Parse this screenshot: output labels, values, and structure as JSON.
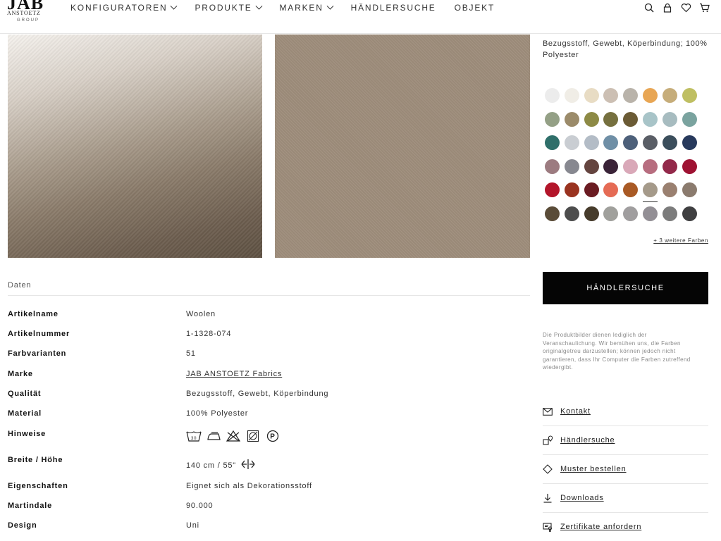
{
  "header": {
    "logo_main": "JAB",
    "logo_sub": "ANSTOETZ",
    "logo_group": "GROUP",
    "nav": [
      {
        "label": "KONFIGURATOREN",
        "has_dropdown": true
      },
      {
        "label": "PRODUKTE",
        "has_dropdown": true
      },
      {
        "label": "MARKEN",
        "has_dropdown": true
      },
      {
        "label": "HÄNDLERSUCHE",
        "has_dropdown": false
      },
      {
        "label": "OBJEKT",
        "has_dropdown": false
      }
    ],
    "icons": [
      "search-icon",
      "lock-icon",
      "heart-icon",
      "cart-icon"
    ]
  },
  "product": {
    "description": "Bezugsstoff, Gewebt, Köperbindung; 100% Polyester",
    "image_colors": {
      "detail_image": "#8a7b6a",
      "flat_image": "#a08f7d"
    }
  },
  "data": {
    "title": "Daten",
    "rows": [
      {
        "key": "Artikelname",
        "value": "Woolen"
      },
      {
        "key": "Artikelnummer",
        "value": "1-1328-074"
      },
      {
        "key": "Farbvarianten",
        "value": "51"
      },
      {
        "key": "Marke",
        "value": "JAB ANSTOETZ Fabrics",
        "link": true
      },
      {
        "key": "Qualität",
        "value": "Bezugsstoff, Gewebt, Köperbindung"
      },
      {
        "key": "Material",
        "value": "100% Polyester"
      },
      {
        "key": "Hinweise",
        "value": "",
        "care_icons": [
          "wash-30-icon",
          "iron-icon",
          "no-bleach-icon",
          "tumble-dry-icon",
          "professional-clean-p-icon"
        ]
      },
      {
        "key": "Breite / Höhe",
        "value": "140 cm / 55\"",
        "icon": "railroaded-icon"
      },
      {
        "key": "Eigenschaften",
        "value": "Eignet sich als Dekorationsstoff"
      },
      {
        "key": "Martindale",
        "value": "90.000"
      },
      {
        "key": "Design",
        "value": "Uni"
      }
    ]
  },
  "colors": {
    "swatches": [
      "#ececec",
      "#f0ede6",
      "#e8dcc4",
      "#ccbfb3",
      "#b9b3aa",
      "#e8a654",
      "#c6ad7a",
      "#bfbf62",
      "#94a086",
      "#9b8b6a",
      "#8d8a45",
      "#76703f",
      "#6b5b35",
      "#a8c4c8",
      "#a7bcc0",
      "#7aa39f",
      "#2f6f6a",
      "#c9cdd2",
      "#b3bcc6",
      "#6f8fa6",
      "#4d607a",
      "#5a5e66",
      "#3b4e5c",
      "#27395c",
      "#9c7b80",
      "#878890",
      "#64443f",
      "#3a2338",
      "#d9a8b8",
      "#b76d7f",
      "#93294a",
      "#9e1232",
      "#b3152a",
      "#9a3320",
      "#6b1c22",
      "#e56b55",
      "#a95a25",
      "#a59a8a",
      "#9a8070",
      "#8b7b6e",
      "#5a4c38",
      "#4d4d4d",
      "#463b2b",
      "#a0a09c",
      "#a09e9f",
      "#938f95",
      "#7c7c7c",
      "#3f3f41"
    ],
    "selected_index": 37,
    "more_label": "+ 3 weitere Farben"
  },
  "actions": {
    "dealer_button": "HÄNDLERSUCHE",
    "disclaimer": "Die Produktbilder dienen lediglich der Veranschaulichung. Wir bemühen uns, die Farben originalgetreu darzustellen; können jedoch nicht garantieren, dass Ihr Computer die Farben zutreffend wiedergibt.",
    "links": [
      {
        "label": "Kontakt",
        "icon": "mail-icon"
      },
      {
        "label": "Händlersuche",
        "icon": "store-locator-icon"
      },
      {
        "label": "Muster bestellen",
        "icon": "sample-tag-icon"
      },
      {
        "label": "Downloads",
        "icon": "download-icon"
      },
      {
        "label": "Zertifikate anfordern",
        "icon": "certificate-icon"
      }
    ]
  }
}
